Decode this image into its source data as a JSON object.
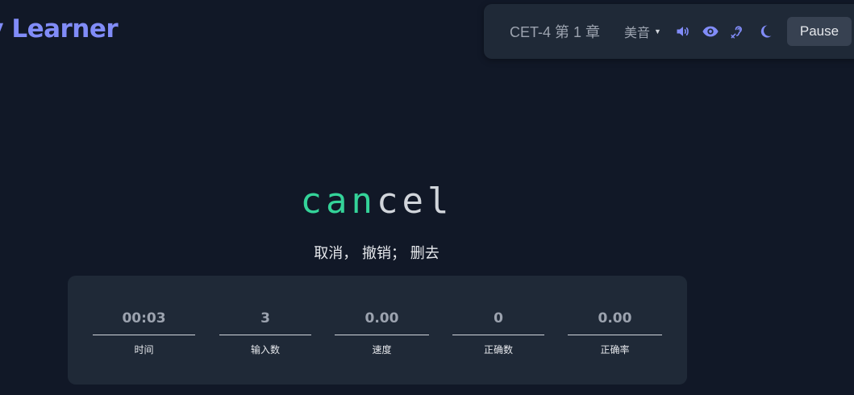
{
  "app": {
    "title": "ty Learner"
  },
  "toolbar": {
    "dict_chapter": "CET-4 第 1 章",
    "pronunciation": "美音",
    "icons": [
      "speaker-icon",
      "eye-icon",
      "hearing-icon",
      "moon-icon"
    ],
    "pause_label": "Pause"
  },
  "word": {
    "typed": "can",
    "untyped": "cel",
    "translation": "取消， 撤销； 删去"
  },
  "stats": [
    {
      "value": "00:03",
      "label": "时间"
    },
    {
      "value": "3",
      "label": "输入数"
    },
    {
      "value": "0.00",
      "label": "速度"
    },
    {
      "value": "0",
      "label": "正确数"
    },
    {
      "value": "0.00",
      "label": "正确率"
    }
  ],
  "colors": {
    "background": "#111827",
    "panel": "#1f2937",
    "accent": "#818cf8",
    "typed": "#34d399"
  }
}
